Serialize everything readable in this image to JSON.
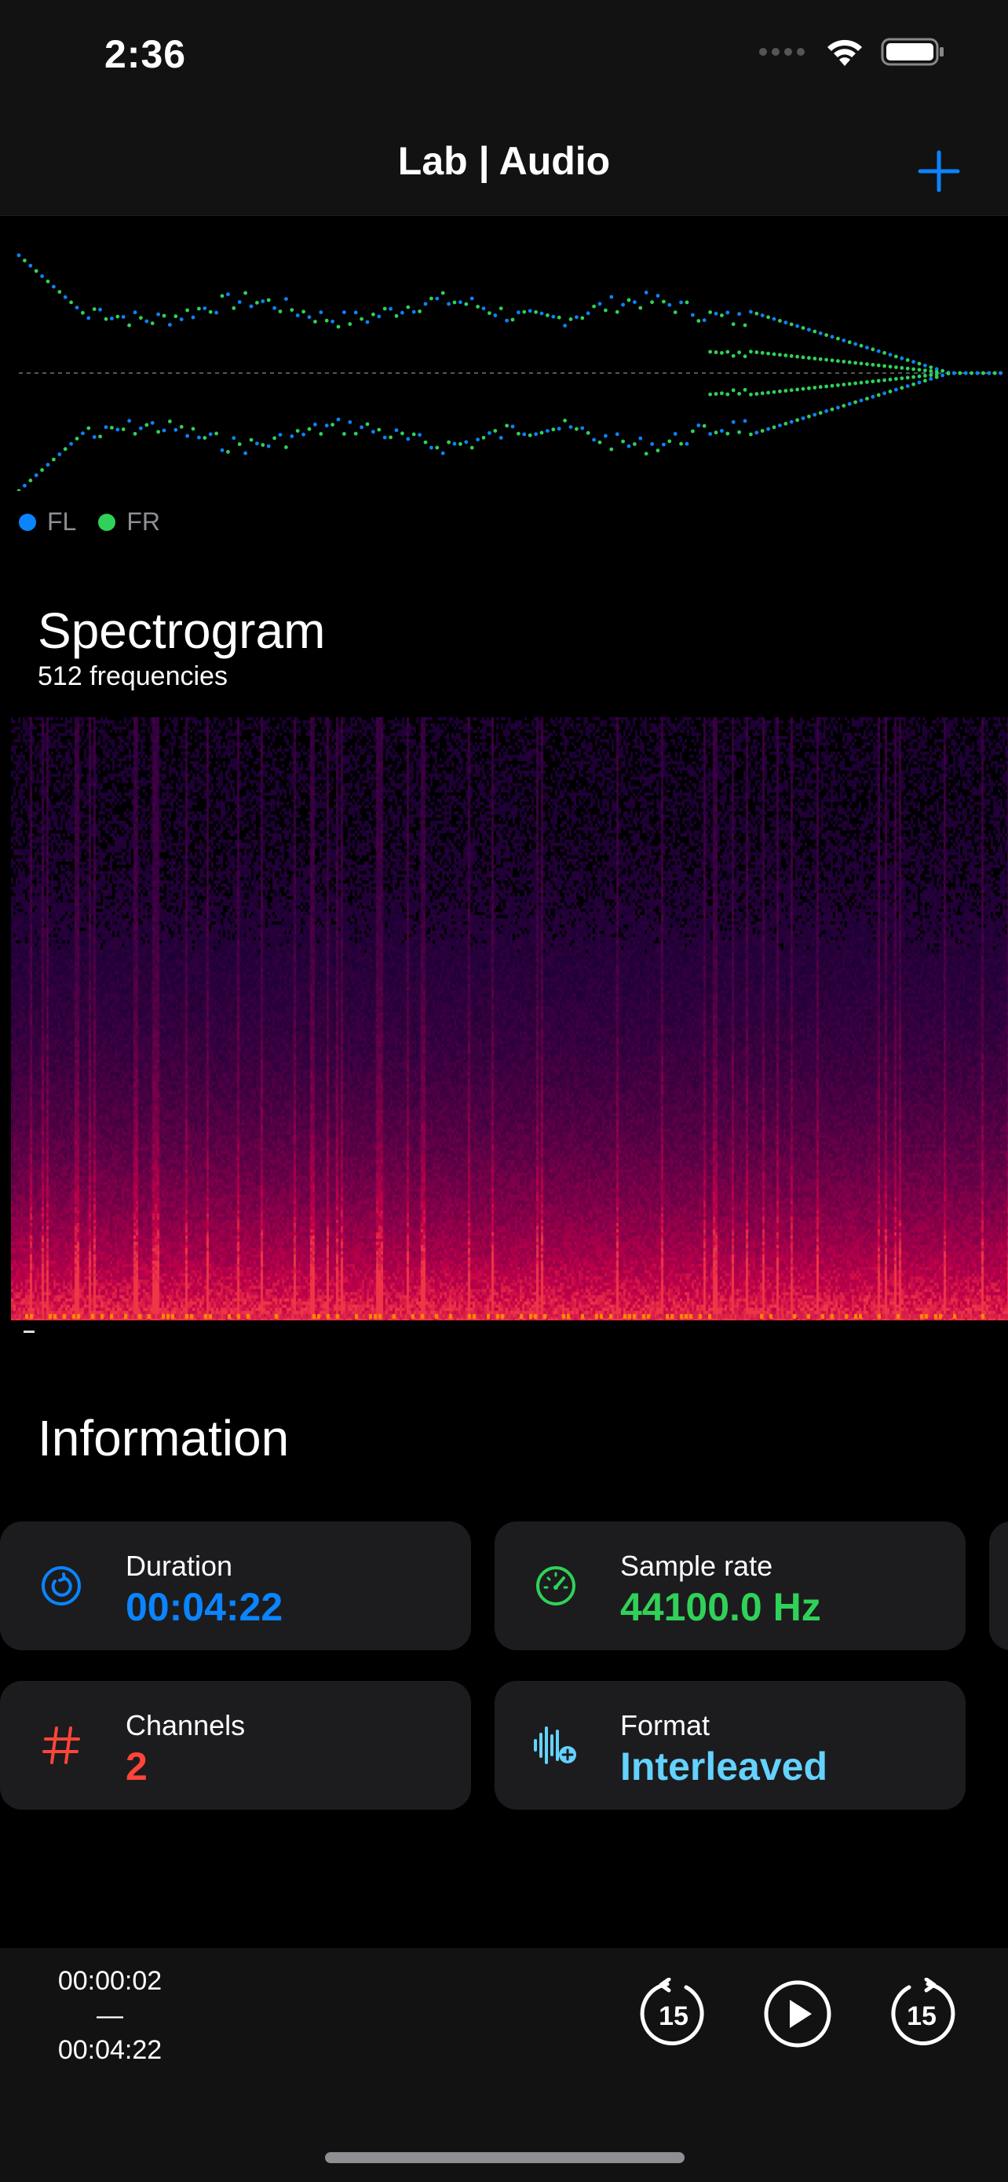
{
  "status": {
    "time": "2:36"
  },
  "nav": {
    "title": "Lab | Audio",
    "add_icon": "plus-icon"
  },
  "waveform": {
    "legend": [
      {
        "label": "FL",
        "color": "#0a84ff"
      },
      {
        "label": "FR",
        "color": "#30d158"
      }
    ]
  },
  "spectrogram": {
    "title": "Spectrogram",
    "subtitle": "512 frequencies"
  },
  "information": {
    "title": "Information",
    "cards": [
      {
        "label": "Duration",
        "value": "00:04:22",
        "icon": "clock-icon",
        "color": "#0a84ff"
      },
      {
        "label": "Sample rate",
        "value": "44100.0 Hz",
        "icon": "gauge-icon",
        "color": "#30d158"
      },
      {
        "label": "Channels",
        "value": "2",
        "icon": "hash-icon",
        "color": "#ff453a"
      },
      {
        "label": "Format",
        "value": "Interleaved",
        "icon": "waveform-icon",
        "color": "#64d2ff"
      }
    ]
  },
  "player": {
    "current_time": "00:00:02",
    "separator": "—",
    "total_time": "00:04:22",
    "skip_back_label": "15",
    "skip_forward_label": "15"
  }
}
